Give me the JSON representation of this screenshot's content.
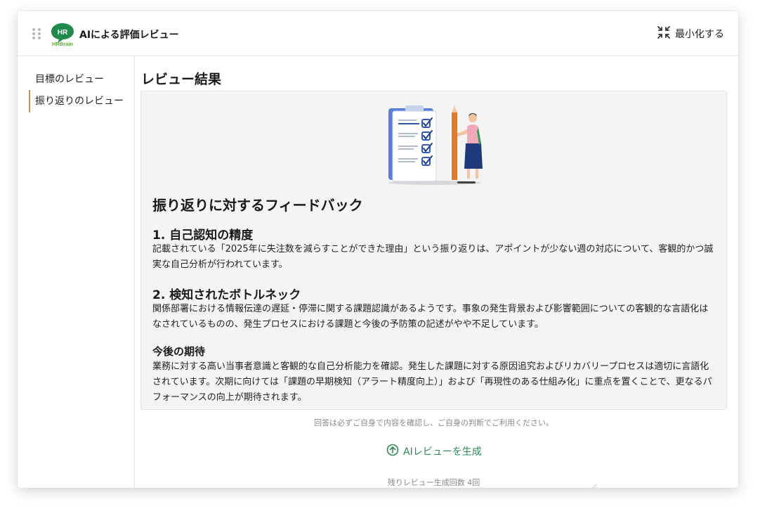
{
  "header": {
    "logo_text": "HR",
    "logo_subtext": "HRBrain",
    "title": "AIによる評価レビュー",
    "minimize_label": "最小化する"
  },
  "sidebar": {
    "items": [
      {
        "label": "目標のレビュー"
      },
      {
        "label": "振り返りのレビュー"
      }
    ]
  },
  "main": {
    "title": "レビュー結果",
    "feedback_title": "振り返りに対するフィードバック",
    "sections": [
      {
        "heading": "1. 自己認知の精度",
        "body": "記載されている「2025年に失注数を減らすことができた理由」という振り返りは、アポイントが少ない週の対応について、客観的かつ誠実な自己分析が行われています。"
      },
      {
        "heading": "2. 検知されたボトルネック",
        "body": "関係部署における情報伝達の遅延・停滞に関する課題認識があるようです。事象の発生背景および影響範囲についての客観的な言語化はなされているものの、発生プロセスにおける課題と今後の予防策の記述がやや不足しています。"
      },
      {
        "heading": "今後の期待",
        "body": "業務に対する高い当事者意識と客観的な自己分析能力を確認。発生した課題に対する原因追究およびリカバリープロセスは適切に言語化されています。次期に向けては「課題の早期検知（アラート精度向上）」および「再現性のある仕組み化」に重点を置くことで、更なるパフォーマンスの向上が期待されます。"
      }
    ],
    "disclaimer": "回答は必ずご自身で内容を確認し、ご自身の判断でご利用ください。",
    "generate_label": "AIレビューを生成",
    "remaining": "残りレビュー生成回数 4回"
  },
  "colors": {
    "brand_green": "#2e8b57",
    "logo_green": "#1f8a4c",
    "active_accent": "#c99145",
    "card_bg": "#f4f4f4"
  },
  "icons": {
    "drag": "drag-handle-icon",
    "minimize": "collapse-arrows-icon",
    "generate": "arrow-up-circle-icon",
    "illustration": "checklist-illustration"
  }
}
